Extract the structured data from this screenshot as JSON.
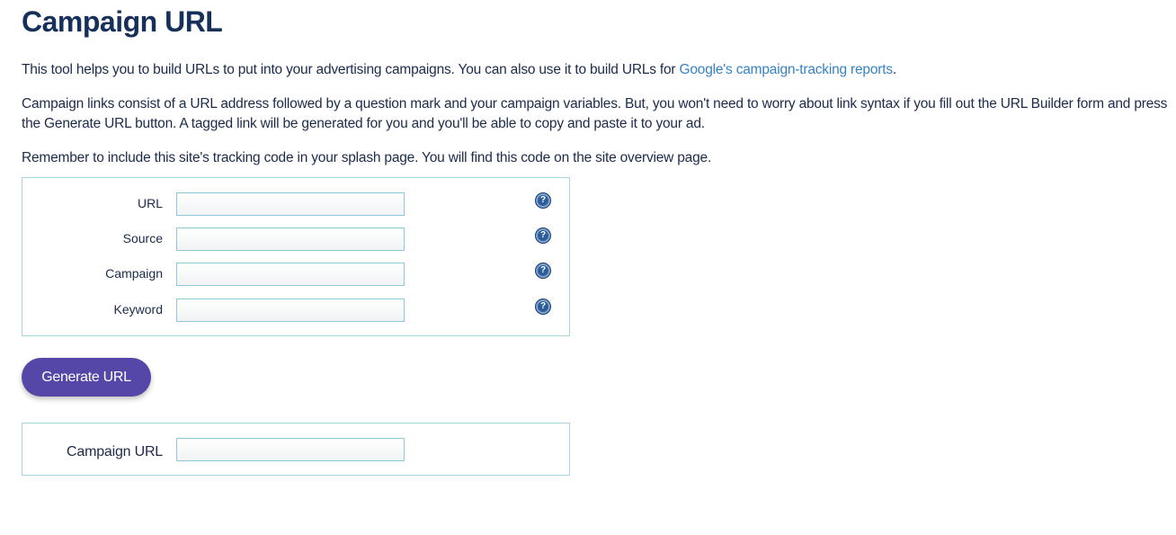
{
  "page": {
    "title": "Campaign URL",
    "intro": {
      "text": "This tool helps you to build URLs to put into your advertising campaigns. You can also use it to build URLs for ",
      "link_text": "Google's campaign-tracking reports",
      "suffix": "."
    },
    "paragraph2": "Campaign links consist of a URL address followed by a question mark and your campaign variables. But, you won't need to worry about link syntax if you fill out the URL Builder form and press the Generate URL button. A tagged link will be generated for you and you'll be able to copy and paste it to your ad.",
    "paragraph3": "Remember to include this site's tracking code in your splash page. You will find this code on the site overview page."
  },
  "form": {
    "fields": [
      {
        "label": "URL",
        "value": "",
        "help_icon": "question-mark-icon"
      },
      {
        "label": "Source",
        "value": "",
        "help_icon": "question-mark-icon"
      },
      {
        "label": "Campaign",
        "value": "",
        "help_icon": "question-mark-icon"
      },
      {
        "label": "Keyword",
        "value": "",
        "help_icon": "question-mark-icon"
      }
    ],
    "help_glyph": "?"
  },
  "generate_button": {
    "label": "Generate URL"
  },
  "result": {
    "label": "Campaign URL",
    "value": ""
  },
  "colors": {
    "heading": "#17305a",
    "link": "#3582c4",
    "button": "#5547a8",
    "border": "#a8d6e0"
  }
}
